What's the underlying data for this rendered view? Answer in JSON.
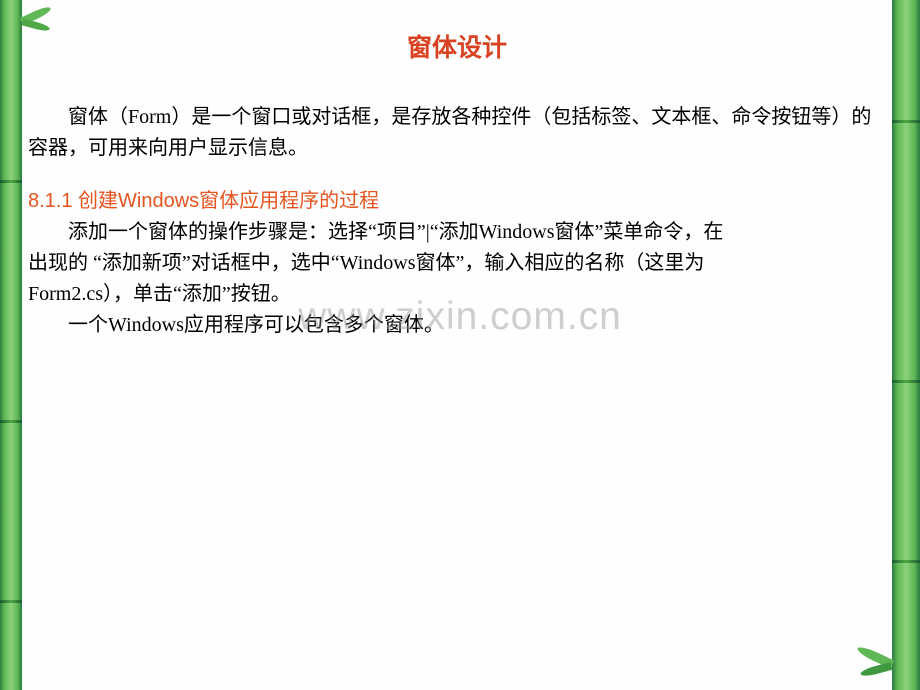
{
  "title": "窗体设计",
  "paragraph_intro": "窗体（Form）是一个窗口或对话框，是存放各种控件（包括标签、文本框、命令按钮等）的容器，可用来向用户显示信息。",
  "section_heading": "8.1.1 创建Windows窗体应用程序的过程",
  "paragraph_steps_line1": "添加一个窗体的操作步骤是：选择“项目”|“添加Windows窗体”菜单命令，在",
  "paragraph_steps_line2": "出现的 “添加新项”对话框中，选中“Windows窗体”，输入相应的名称（这里为",
  "paragraph_steps_line3": "Form2.cs），单击“添加”按钮。",
  "paragraph_note": "一个Windows应用程序可以包含多个窗体。",
  "watermark": "www.zixin.com.cn"
}
